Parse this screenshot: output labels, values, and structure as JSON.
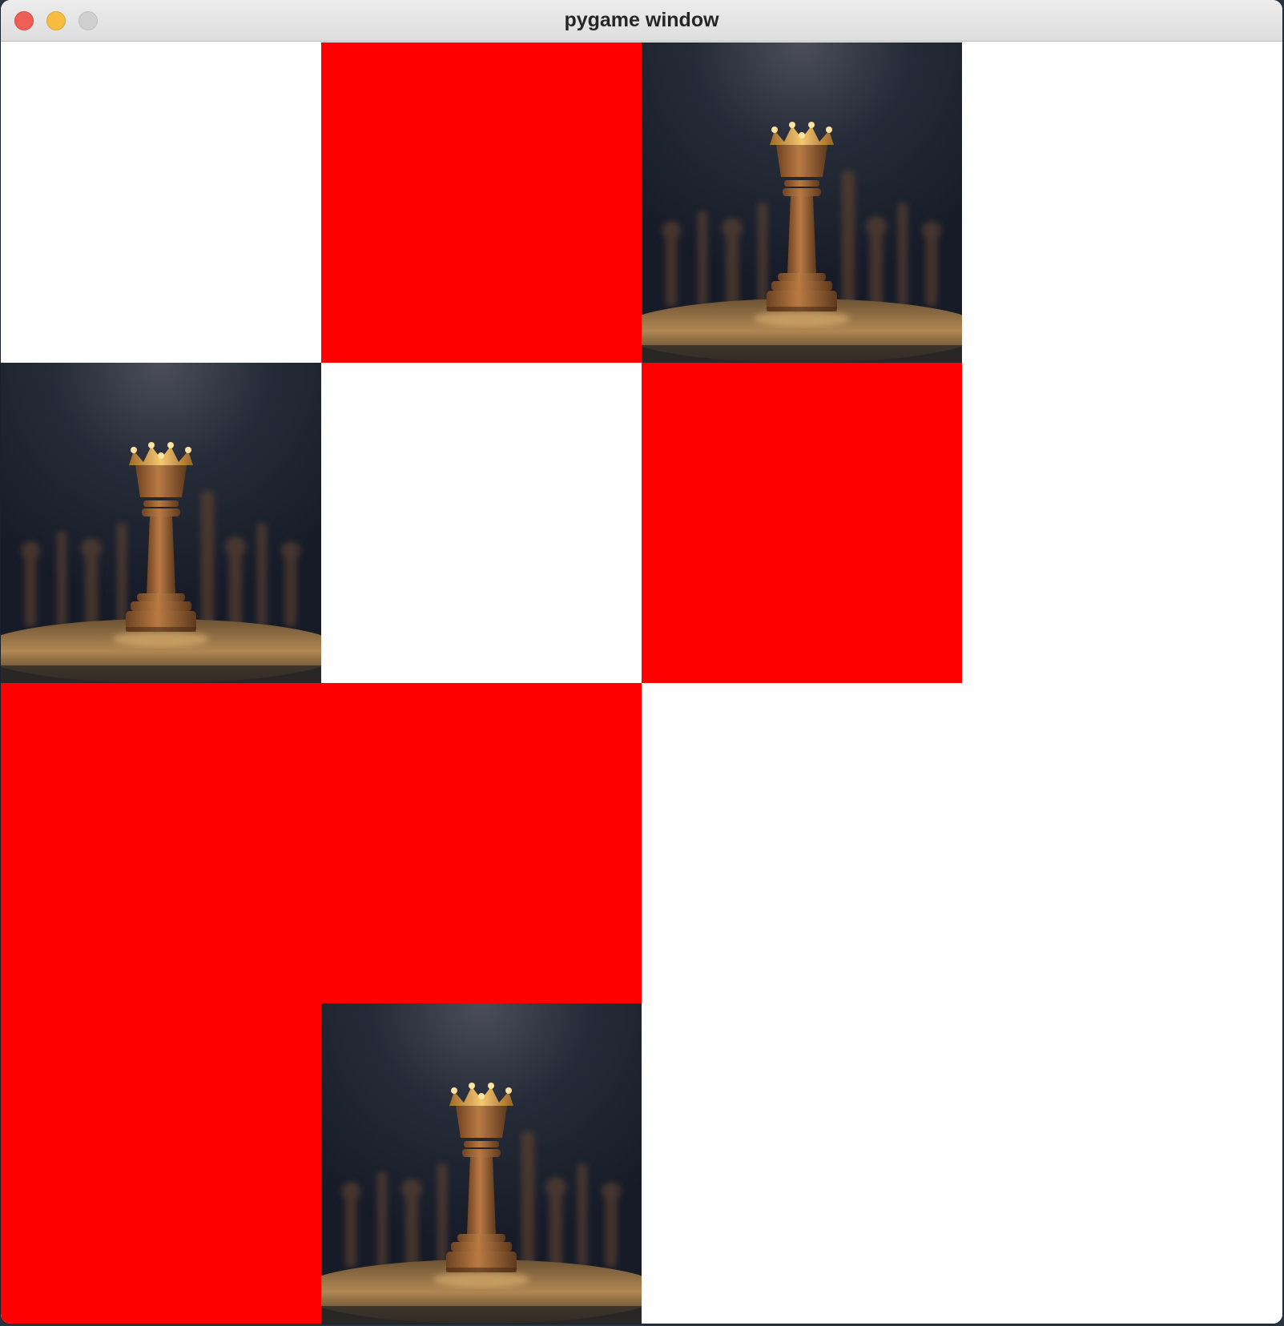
{
  "window": {
    "title": "pygame window"
  },
  "colors": {
    "red": "#ff0000",
    "white": "#ffffff",
    "queen_backdrop": "#171c28"
  },
  "board": {
    "rows": 4,
    "cols": 4,
    "cells": [
      [
        "white",
        "red",
        "queen",
        "white"
      ],
      [
        "queen",
        "white",
        "red",
        "white"
      ],
      [
        "red",
        "red",
        "white",
        "white"
      ],
      [
        "red",
        "queen",
        "white",
        "white"
      ]
    ],
    "queen_icon": "chess-queen-photo-icon"
  }
}
